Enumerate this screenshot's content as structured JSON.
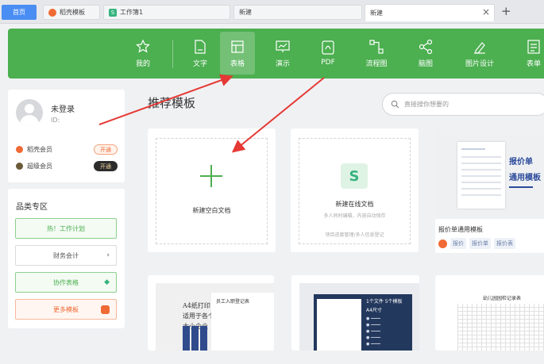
{
  "tabs": [
    {
      "label": "首页"
    },
    {
      "label": "稻壳模板"
    },
    {
      "label": "工作簿1"
    },
    {
      "label": "新建"
    },
    {
      "label": "新建"
    }
  ],
  "toolbar": {
    "items": [
      {
        "label": "我的",
        "icon": "star-icon"
      },
      {
        "label": "文字",
        "icon": "document-icon"
      },
      {
        "label": "表格",
        "icon": "table-icon"
      },
      {
        "label": "演示",
        "icon": "presentation-icon"
      },
      {
        "label": "PDF",
        "icon": "pdf-icon"
      },
      {
        "label": "流程图",
        "icon": "flowchart-icon"
      },
      {
        "label": "脑图",
        "icon": "mindmap-icon"
      },
      {
        "label": "图片设计",
        "icon": "image-design-icon"
      },
      {
        "label": "表单",
        "icon": "form-icon"
      }
    ],
    "active": "表格",
    "color": "#4caf50"
  },
  "user": {
    "name": "未登录",
    "id_label": "ID:",
    "vip": [
      {
        "label": "稻壳会员",
        "button": "开通"
      },
      {
        "label": "超级会员",
        "button": "开通"
      }
    ]
  },
  "category": {
    "title": "品类专区",
    "items": [
      {
        "label": "热！工作计划"
      },
      {
        "label": "财务会计"
      },
      {
        "label": "协作表格"
      },
      {
        "label": "更多模板"
      }
    ]
  },
  "main": {
    "title": "推荐模板",
    "search_placeholder": "直接搜你想要的",
    "cards": {
      "blank": {
        "label": "新建空白文档"
      },
      "online": {
        "label": "新建在线文档",
        "sub1": "多人同时编辑，内容自动保存",
        "sub2": "项目进度管理/多人信息登记"
      },
      "quote": {
        "title": "报价单通用模板",
        "thumb_line1": "报价单",
        "thumb_line2": "通用模板",
        "tags": [
          "报价",
          "报价单",
          "报价表"
        ]
      }
    },
    "bottom": {
      "b1_lines": [
        "A4纸打印",
        "适用于各个",
        "大小企业"
      ],
      "b1_form_title": "员工入职登记表",
      "b2_title": "1个文件 5个模板",
      "b2_sub": "A4尺寸",
      "b3_title": "幼儿园园检记录表"
    }
  }
}
